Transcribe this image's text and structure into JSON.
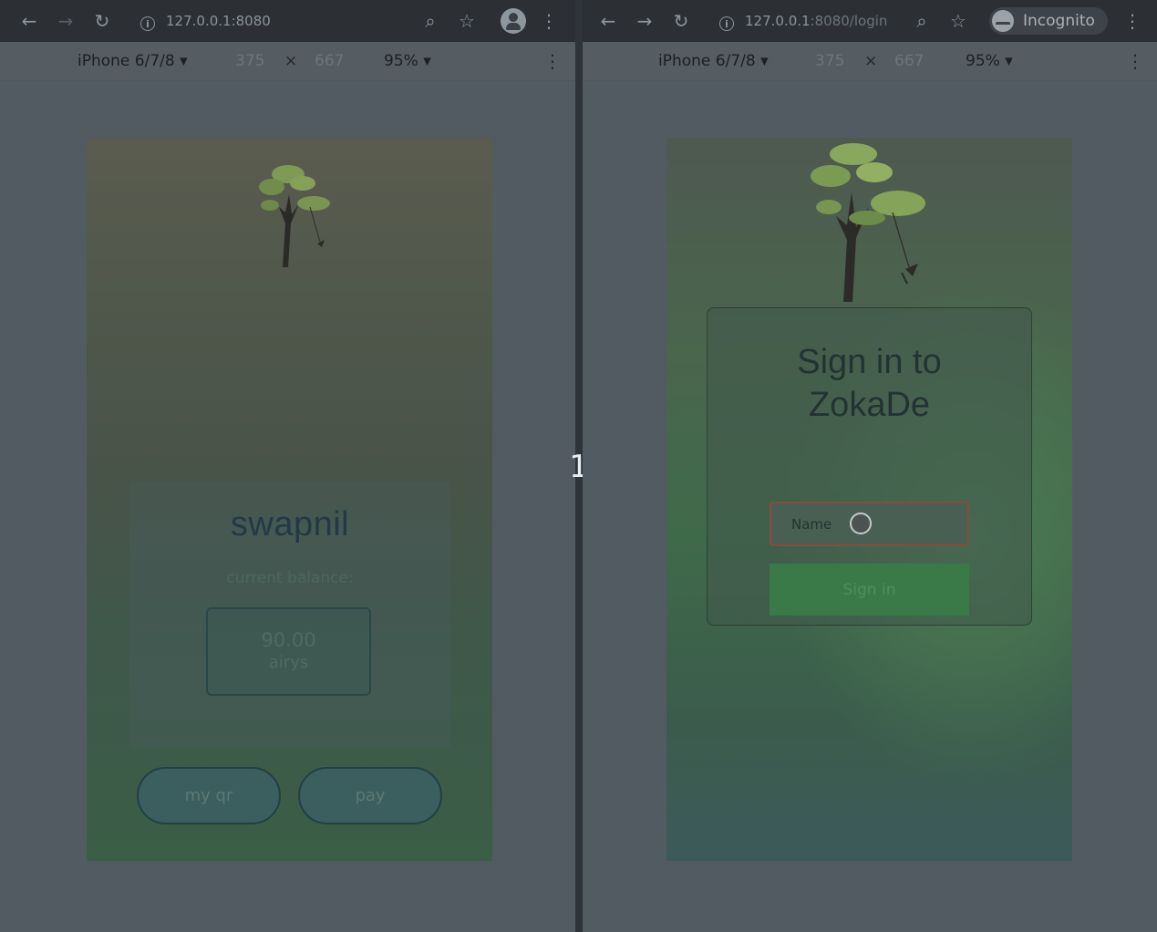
{
  "left": {
    "url": "127.0.0.1:8080",
    "device": "iPhone 6/7/8",
    "width": "375",
    "height": "667",
    "zoom": "95%",
    "page": {
      "username": "swapnil",
      "balance_label": "current balance:",
      "balance_amount": "90.00",
      "balance_unit": "airys",
      "my_qr_label": "my qr",
      "pay_label": "pay"
    }
  },
  "right": {
    "url_host": "127.0.0.1",
    "url_rest": ":8080/login",
    "incognito_label": "Incognito",
    "device": "iPhone 6/7/8",
    "width": "375",
    "height": "667",
    "zoom": "95%",
    "page": {
      "title_line1": "Sign in to",
      "title_line2": "ZokaDe",
      "name_placeholder": "Name",
      "signin_label": "Sign in"
    }
  },
  "divider_label": "1",
  "icons": [
    "back-arrow-icon",
    "forward-arrow-icon",
    "reload-icon",
    "info-icon",
    "zoom-icon",
    "star-icon",
    "profile-icon",
    "menu-dots-icon",
    "incognito-icon",
    "dropdown-arrow-icon",
    "tree-illustration"
  ]
}
